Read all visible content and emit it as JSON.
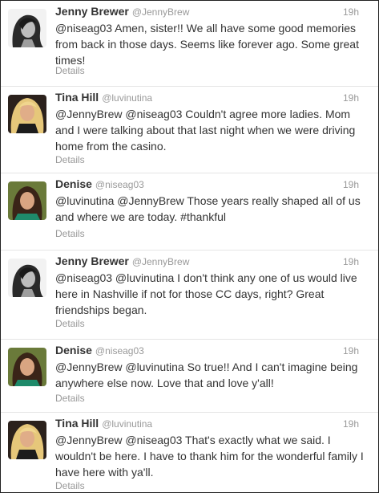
{
  "tweets": [
    {
      "name": "Jenny Brewer",
      "handle": "@JennyBrew",
      "time": "19h",
      "text": "@niseag03 Amen, sister!! We all have some good memories from back in those days. Seems like forever ago. Some great times!",
      "details": "Details",
      "avatar": "jenny"
    },
    {
      "name": "Tina Hill",
      "handle": "@luvinutina",
      "time": "19h",
      "text": "@JennyBrew @niseag03 Couldn't agree more ladies. Mom and I were talking about that last night when we were driving home from the casino.",
      "details": "Details",
      "avatar": "tina"
    },
    {
      "name": "Denise",
      "handle": "@niseag03",
      "time": "19h",
      "text": "@luvinutina @JennyBrew Those years really shaped all of us and where we are today. #thankful",
      "details": "Details",
      "avatar": "denise"
    },
    {
      "name": "Jenny Brewer",
      "handle": "@JennyBrew",
      "time": "19h",
      "text": "@niseag03 @luvinutina I don't think any one of us would live here in Nashville if not for those CC days, right? Great friendships began.",
      "details": "Details",
      "avatar": "jenny"
    },
    {
      "name": "Denise",
      "handle": "@niseag03",
      "time": "19h",
      "text": "@JennyBrew @luvinutina So true!! And I can't imagine being anywhere else now. Love that and love y'all!",
      "details": "Details",
      "avatar": "denise"
    },
    {
      "name": "Tina Hill",
      "handle": "@luvinutina",
      "time": "19h",
      "text": "@JennyBrew @niseag03 That's exactly what we said. I wouldn't be here. I have to thank him for the wonderful family I have here with ya'll.",
      "details": "Details",
      "avatar": "tina"
    }
  ]
}
